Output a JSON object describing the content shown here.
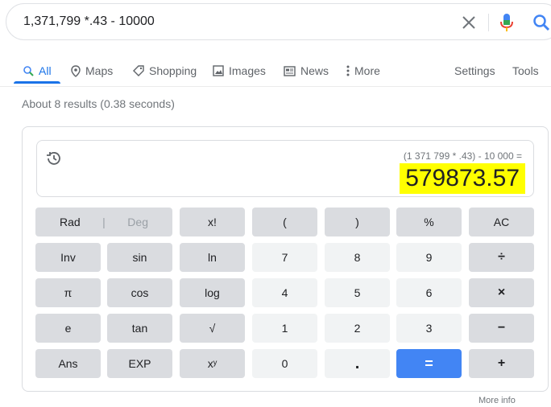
{
  "search": {
    "query": "1,371,799 *.43 - 10000"
  },
  "tabs": {
    "all": "All",
    "maps": "Maps",
    "shopping": "Shopping",
    "images": "Images",
    "news": "News",
    "more": "More",
    "settings": "Settings",
    "tools": "Tools"
  },
  "results_count": "About 8 results (0.38 seconds)",
  "calculator": {
    "expression": "(1 371 799 * .43) - 10 000 =",
    "result": "579873.57",
    "keys": {
      "rad": "Rad",
      "deg": "Deg",
      "row1": [
        "x!",
        "(",
        ")",
        "%",
        "AC"
      ],
      "row2": [
        "Inv",
        "sin",
        "ln",
        "7",
        "8",
        "9",
        "÷"
      ],
      "row3": [
        "π",
        "cos",
        "log",
        "4",
        "5",
        "6",
        "×"
      ],
      "row4": [
        "e",
        "tan",
        "√",
        "1",
        "2",
        "3",
        "−"
      ],
      "row5": [
        "Ans",
        "EXP",
        "xʸ",
        "0",
        ".",
        "=",
        "+"
      ]
    }
  },
  "more_info": "More info",
  "colors": {
    "accent": "#1a73e8",
    "equals_key": "#4285f4",
    "highlight": "#ffff00"
  }
}
